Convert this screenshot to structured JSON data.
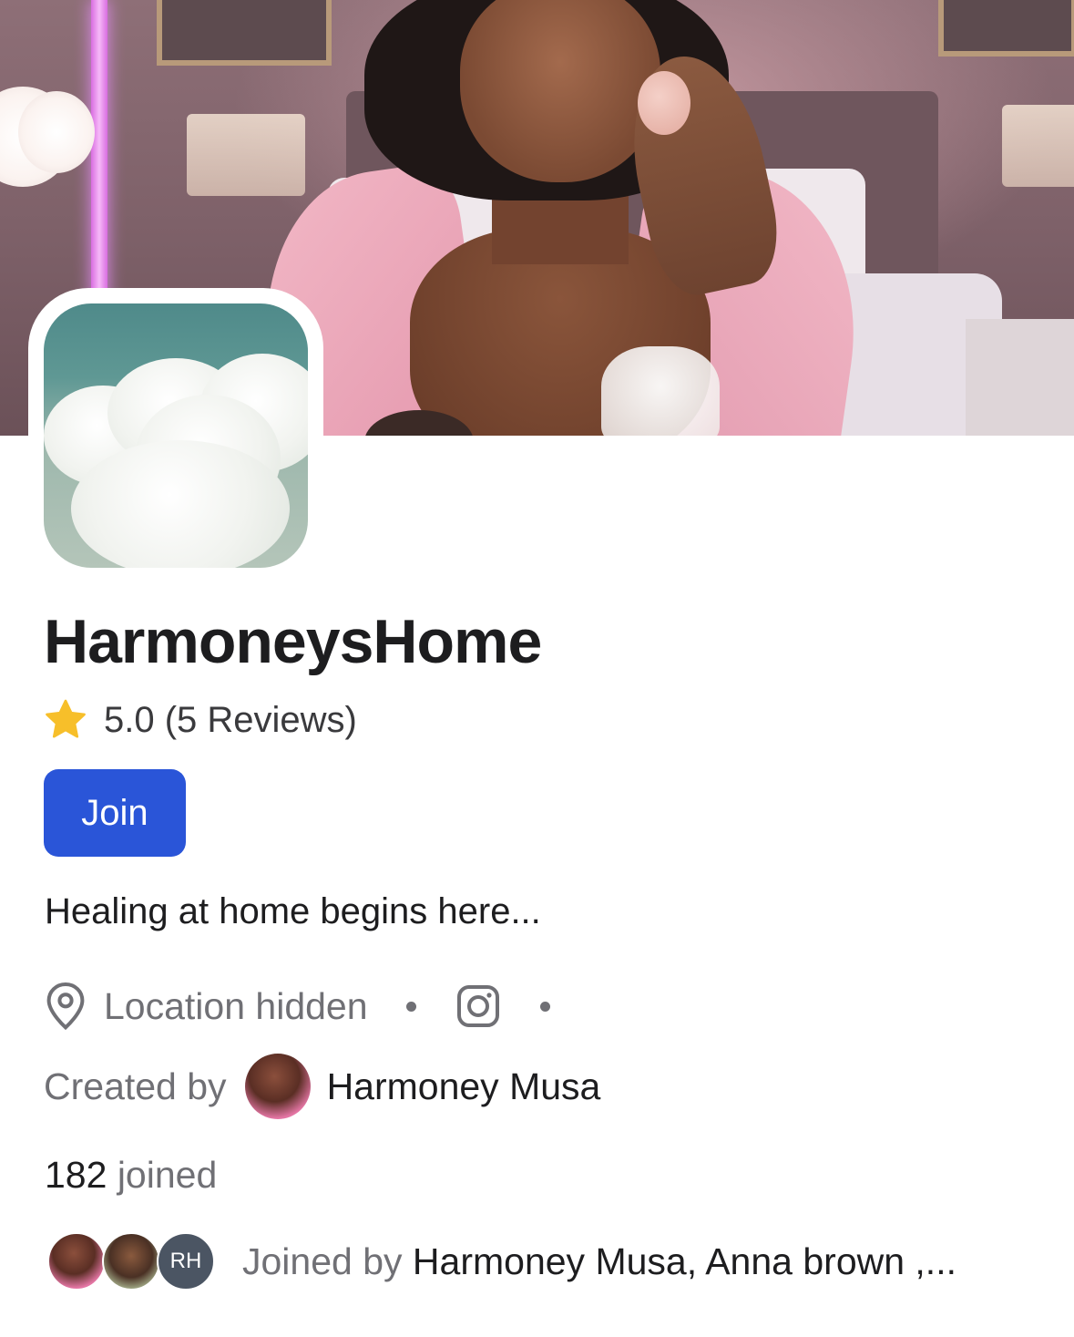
{
  "community": {
    "name": "HarmoneysHome",
    "rating_text": "5.0 (5 Reviews)",
    "join_label": "Join",
    "description": "Healing at home begins here...",
    "location": "Location hidden",
    "created_by_label": "Created by",
    "creator_name": "Harmoney Musa",
    "joined_count": "182",
    "joined_label": "joined",
    "member_avatar_initials": "RH",
    "joined_by_label": "Joined by",
    "joined_by_names": "Harmoney Musa, Anna brown ,..."
  },
  "colors": {
    "join_button": "#2a55d8",
    "star": "#f7bf2a",
    "muted_text": "#707075"
  },
  "icons": [
    "star-icon",
    "location-pin-icon",
    "instagram-icon"
  ]
}
